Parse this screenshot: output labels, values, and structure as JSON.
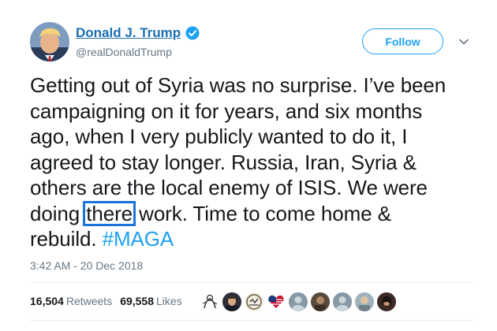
{
  "user": {
    "display_name": "Donald J. Trump",
    "handle": "@realDonaldTrump",
    "verified": true,
    "avatar_icon": "profile-photo"
  },
  "actions": {
    "follow_label": "Follow",
    "menu_icon": "chevron-down-icon"
  },
  "tweet": {
    "lines": [
      "Getting out of Syria was no surprise. I’ve been",
      "campaigning on it for years, and six months",
      "ago, when I very publicly wanted to do it, I",
      "agreed to stay longer. Russia, Iran, Syria &",
      "others are the local enemy of ISIS. We were"
    ],
    "line6_before": "doing ",
    "line6_highlight": "there",
    "line6_after": " work. Time to come home &",
    "line7_text": "rebuild. ",
    "hashtag": "#MAGA",
    "timestamp": "3:42 AM - 20 Dec 2018"
  },
  "stats": {
    "retweets_count": "16,504",
    "retweets_label": "Retweets",
    "likes_count": "69,558",
    "likes_label": "Likes"
  },
  "liker_avatars": [
    {
      "icon": "avatar-sketch"
    },
    {
      "icon": "avatar-portrait"
    },
    {
      "icon": "avatar-logo"
    },
    {
      "icon": "avatar-flag-heart"
    },
    {
      "icon": "avatar-default"
    },
    {
      "icon": "avatar-photo"
    },
    {
      "icon": "avatar-default"
    },
    {
      "icon": "avatar-photo"
    },
    {
      "icon": "avatar-photo"
    }
  ],
  "colors": {
    "name": "#1c6fb0",
    "link": "#1da1f2",
    "secondary": "#657786",
    "highlight_box": "#1a73d9",
    "divider": "#e6ecf0"
  }
}
